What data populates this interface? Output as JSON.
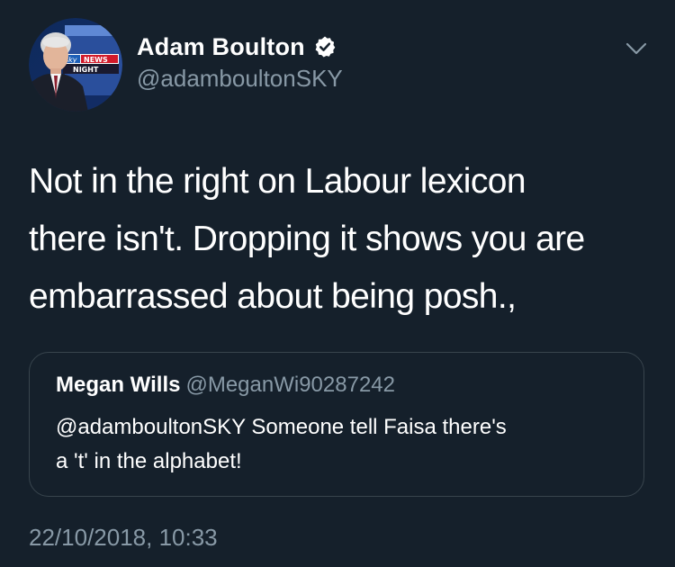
{
  "author": {
    "name": "Adam Boulton",
    "handle": "@adamboultonSKY",
    "verified": true,
    "avatar_overlay": {
      "brand_small": "sky",
      "brand": "NEWS",
      "show": "NIGHT"
    }
  },
  "tweet": {
    "lines": [
      "Not in the right on Labour lexicon",
      "there isn't. Dropping it shows you are",
      "embarrassed about being posh.,"
    ],
    "timestamp": "22/10/2018, 10:33"
  },
  "quoted_tweet": {
    "name": "Megan Wills",
    "handle": "@MeganWi90287242",
    "lines": [
      "@adamboultonSKY Someone tell Faisa there's",
      "a 't' in the alphabet!"
    ]
  },
  "icons": {
    "verified": "verified-badge-icon",
    "menu": "chevron-down-icon"
  },
  "colors": {
    "background": "#15202b",
    "primary_text": "#ffffff",
    "secondary_text": "#8899a6",
    "border": "#38444d",
    "verified_badge": "#ffffff",
    "sky_red": "#d21a2a",
    "sky_blue": "#1d5fb8"
  }
}
